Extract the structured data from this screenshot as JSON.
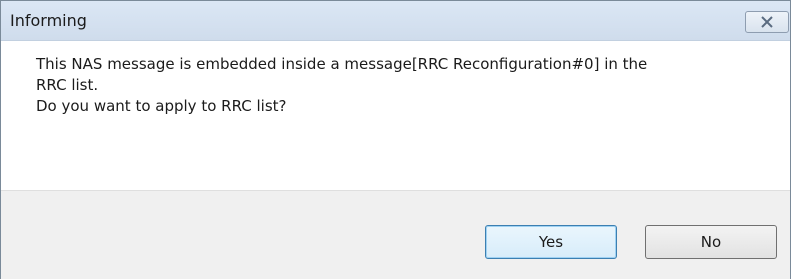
{
  "window": {
    "title": "Informing",
    "close_icon": "close-icon"
  },
  "message": {
    "lines": [
      "This NAS message is embedded inside a message[RRC Reconfiguration#0] in the",
      "RRC list.",
      "Do you want to apply to RRC list?"
    ]
  },
  "buttons": {
    "yes_label": "Yes",
    "no_label": "No"
  }
}
